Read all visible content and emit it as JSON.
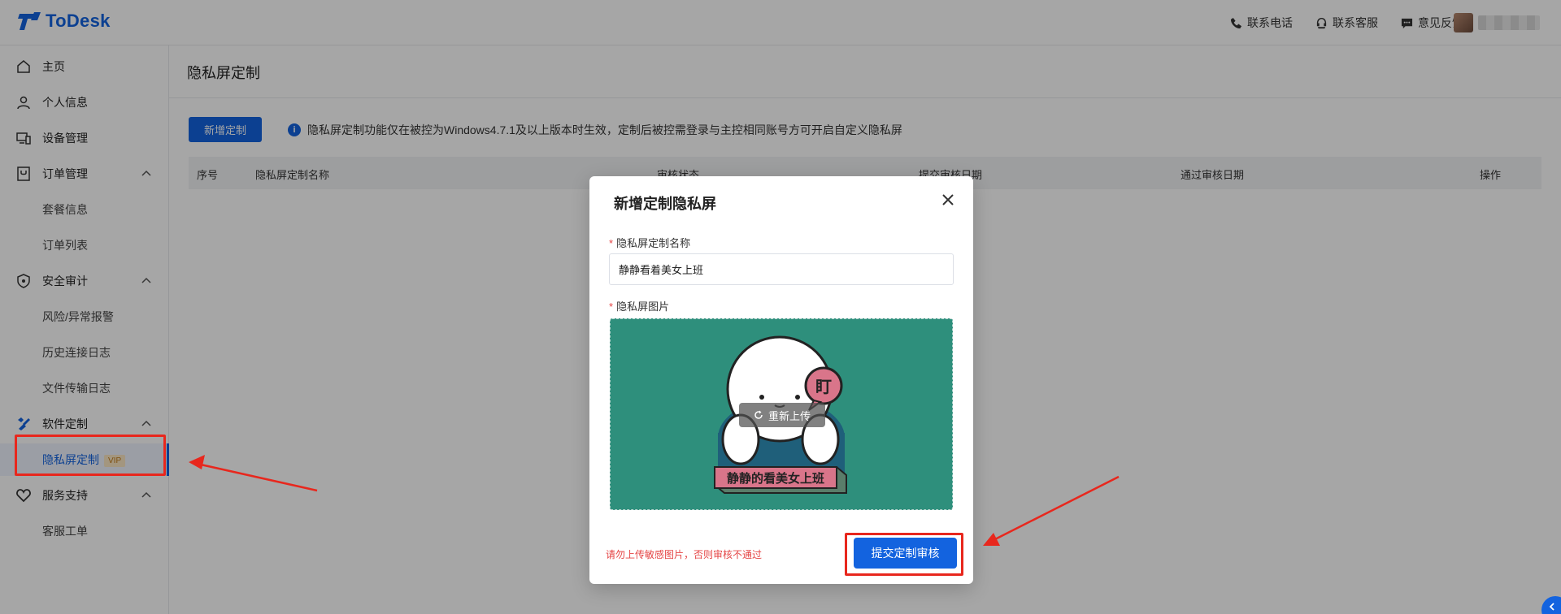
{
  "header": {
    "logo_text": "ToDesk",
    "links": [
      {
        "label": "联系电话",
        "icon": "phone-icon"
      },
      {
        "label": "联系客服",
        "icon": "headset-icon"
      },
      {
        "label": "意见反馈",
        "icon": "chat-icon"
      }
    ]
  },
  "sidebar": {
    "items": [
      {
        "label": "主页",
        "icon": "home-icon"
      },
      {
        "label": "个人信息",
        "icon": "user-icon"
      },
      {
        "label": "设备管理",
        "icon": "device-icon"
      },
      {
        "label": "订单管理",
        "icon": "order-icon",
        "expanded": true
      },
      {
        "label": "套餐信息"
      },
      {
        "label": "订单列表"
      },
      {
        "label": "安全审计",
        "icon": "shield-icon",
        "expanded": true
      },
      {
        "label": "风险/异常报警"
      },
      {
        "label": "历史连接日志"
      },
      {
        "label": "文件传输日志"
      },
      {
        "label": "软件定制",
        "icon": "customize-icon",
        "expanded": true
      },
      {
        "label": "隐私屏定制",
        "badge": "VIP",
        "active": true
      },
      {
        "label": "服务支持",
        "icon": "heart-icon",
        "expanded": true
      },
      {
        "label": "客服工单"
      }
    ]
  },
  "page": {
    "title": "隐私屏定制",
    "new_button": "新增定制",
    "notice": "隐私屏定制功能仅在被控为Windows4.7.1及以上版本时生效，定制后被控需登录与主控相同账号方可开启自定义隐私屏",
    "table_headers": [
      "序号",
      "隐私屏定制名称",
      "审核状态",
      "提交审核日期",
      "通过审核日期",
      "操作"
    ]
  },
  "modal": {
    "title": "新增定制隐私屏",
    "name_label": "隐私屏定制名称",
    "name_value": "静静看着美女上班",
    "image_label": "隐私屏图片",
    "reupload_label": "重新上传",
    "sticker_bubble": "盯",
    "sticker_banner": "静静的看美女上班",
    "warning": "请勿上传敏感图片，否则审核不通过",
    "submit_label": "提交定制审核"
  },
  "colors": {
    "brand": "#1363df",
    "upload_bg": "#2e8f7c",
    "warning": "#e54545",
    "highlight": "#e8271d"
  }
}
